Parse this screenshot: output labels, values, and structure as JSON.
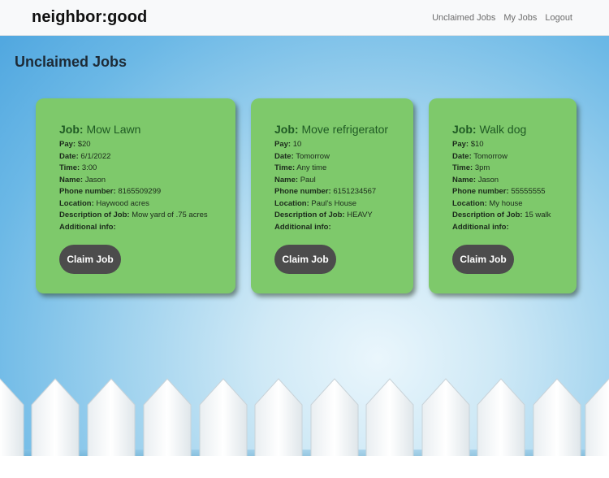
{
  "navbar": {
    "brand": "neighbor:good",
    "links": [
      "Unclaimed Jobs",
      "My Jobs",
      "Logout"
    ]
  },
  "page": {
    "title": "Unclaimed Jobs"
  },
  "labels": {
    "job": "Job:",
    "pay": "Pay:",
    "date": "Date:",
    "time": "Time:",
    "name": "Name:",
    "phone": "Phone number:",
    "location": "Location:",
    "description": "Description of Job:",
    "additional": "Additional info:",
    "claim_button": "Claim Job"
  },
  "jobs": [
    {
      "title": "Mow Lawn",
      "pay": "$20",
      "date": "6/1/2022",
      "time": "3:00",
      "name": "Jason",
      "phone": "8165509299",
      "location": "Haywood acres",
      "description": "Mow yard of .75 acres",
      "additional": ""
    },
    {
      "title": "Move refrigerator",
      "pay": "10",
      "date": "Tomorrow",
      "time": "Any time",
      "name": "Paul",
      "phone": "6151234567",
      "location": "Paul's House",
      "description": "HEAVY",
      "additional": ""
    },
    {
      "title": "Walk dog",
      "pay": "$10",
      "date": "Tomorrow",
      "time": "3pm",
      "name": "Jason",
      "phone": "55555555",
      "location": "My house",
      "description": "15 walk",
      "additional": ""
    }
  ],
  "colors": {
    "card_bg": "#7ec96b",
    "card_title": "#1f5a24",
    "button_bg": "#4c4c4c",
    "navbar_bg": "#f8f9fa",
    "sky": "#6bb8e6",
    "fence": "#ffffff"
  }
}
